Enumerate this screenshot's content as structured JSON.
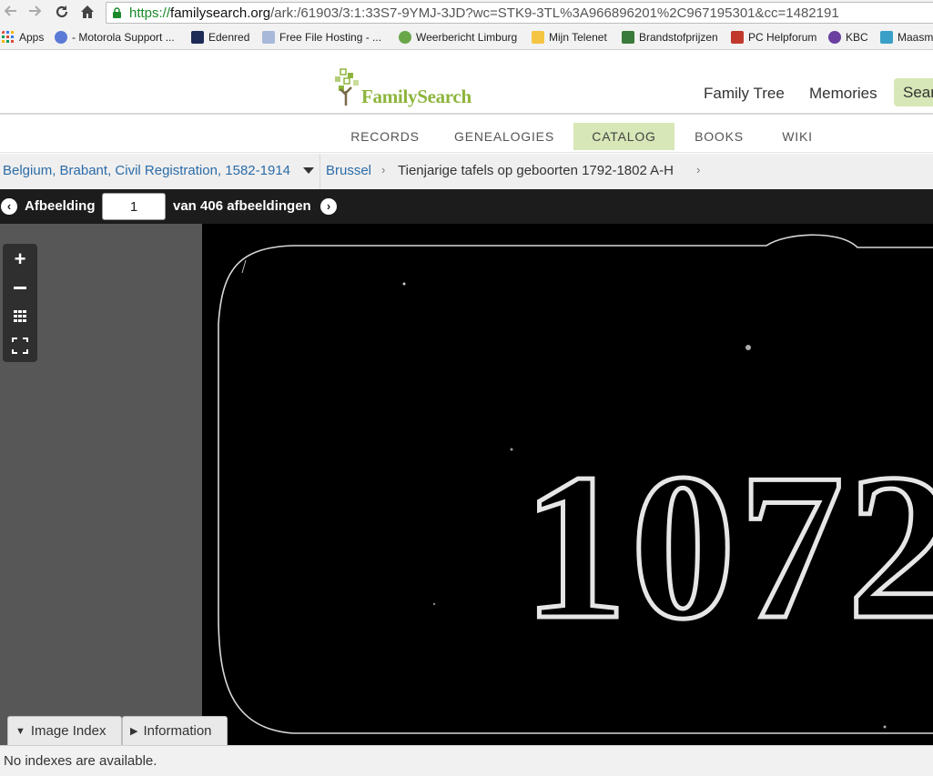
{
  "browser": {
    "url_https": "https://",
    "url_host": "familysearch.org",
    "url_path": "/ark:/61903/3:1:33S7-9YMJ-3JD?wc=STK9-3TL%3A966896201%2C967195301&cc=1482191",
    "bookmarks": [
      {
        "label": "Apps",
        "color": "#e25a3a"
      },
      {
        "label": "- Motorola Support ...",
        "color": "#5b79d6"
      },
      {
        "label": "Edenred",
        "color": "#1d2b57"
      },
      {
        "label": "Free File Hosting - ...",
        "color": "#a8b8d8"
      },
      {
        "label": "Weerbericht Limburg",
        "color": "#6aa64a"
      },
      {
        "label": "Mijn Telenet",
        "color": "#f4c542"
      },
      {
        "label": "Brandstofprijzen",
        "color": "#3a7a3a"
      },
      {
        "label": "PC Helpforum",
        "color": "#c0392b"
      },
      {
        "label": "KBC",
        "color": "#6b3fa0"
      },
      {
        "label": "Maasm",
        "color": "#3aa0c8"
      }
    ]
  },
  "header": {
    "logo_text": "FamilySearch",
    "nav": [
      "Family Tree",
      "Memories"
    ],
    "search_label": "Sear"
  },
  "catalog_nav": {
    "tabs": [
      "RECORDS",
      "GENEALOGIES",
      "CATALOG",
      "BOOKS",
      "WIKI"
    ],
    "active": "CATALOG"
  },
  "breadcrumb": {
    "collection": "Belgium, Brabant, Civil Registration, 1582-1914",
    "place": "Brussel",
    "volume": "Tienjarige tafels op geboorten 1792-1802 A-H"
  },
  "image_bar": {
    "prefix": "Afbeelding",
    "page_value": "1",
    "suffix": "van 406 afbeeldingen"
  },
  "viewer": {
    "image_text": "1072"
  },
  "index_panel": {
    "tabs": [
      "Image Index",
      "Information"
    ],
    "empty_message": "No indexes are available."
  }
}
